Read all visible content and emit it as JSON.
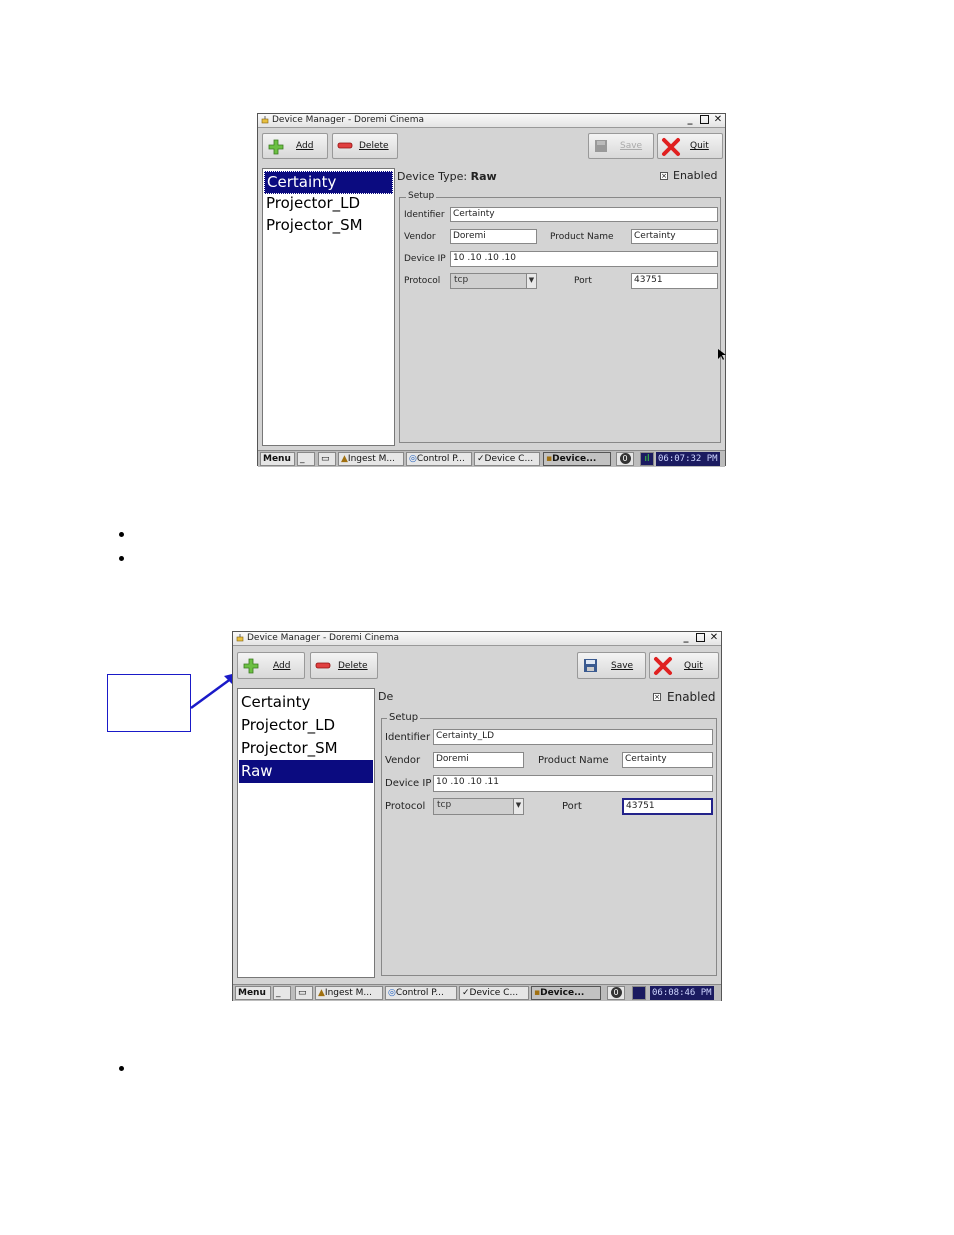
{
  "shot1": {
    "title": "Device Manager - Doremi Cinema",
    "toolbar": {
      "add": "Add",
      "delete": "Delete",
      "save": "Save",
      "quit": "Quit"
    },
    "devices": [
      "Certainty",
      "Projector_LD",
      "Projector_SM"
    ],
    "selected": "Certainty",
    "device_type_label": "Device Type:",
    "device_type_value": "Raw",
    "enabled_label": "Enabled",
    "setup_label": "Setup",
    "fields": {
      "identifier_label": "Identifier",
      "identifier": "Certainty",
      "vendor_label": "Vendor",
      "vendor": "Doremi",
      "product_label": "Product Name",
      "product": "Certainty",
      "ip_label": "Device IP",
      "ip": "10 .10 .10 .10",
      "protocol_label": "Protocol",
      "protocol": "tcp",
      "port_label": "Port",
      "port": "43751"
    },
    "taskbar": {
      "menu": "Menu",
      "min": "_",
      "tasks": [
        "Ingest M...",
        "Control P...",
        "Device C...",
        "Device..."
      ],
      "info": "0",
      "clock": "06:07:32 PM"
    }
  },
  "shot2": {
    "title": "Device Manager - Doremi Cinema",
    "toolbar": {
      "add": "Add",
      "delete": "Delete",
      "save": "Save",
      "quit": "Quit"
    },
    "devices": [
      "Certainty",
      "Projector_LD",
      "Projector_SM",
      "Raw"
    ],
    "selected": "Raw",
    "device_type_label": "De",
    "enabled_label": "Enabled",
    "setup_label": "Setup",
    "fields": {
      "identifier_label": "Identifier",
      "identifier": "Certainty_LD",
      "vendor_label": "Vendor",
      "vendor": "Doremi",
      "product_label": "Product Name",
      "product": "Certainty",
      "ip_label": "Device IP",
      "ip": "10 .10 .10 .11",
      "protocol_label": "Protocol",
      "protocol": "tcp",
      "port_label": "Port",
      "port": "43751"
    },
    "taskbar": {
      "menu": "Menu",
      "min": "_",
      "tasks": [
        "Ingest M...",
        "Control P...",
        "Device C...",
        "Device..."
      ],
      "info": "0",
      "clock": "06:08:46 PM"
    }
  },
  "colors": {
    "selection": "#0b0b80",
    "callout": "#1a1ac8",
    "clock_bg": "#1b1b60"
  }
}
